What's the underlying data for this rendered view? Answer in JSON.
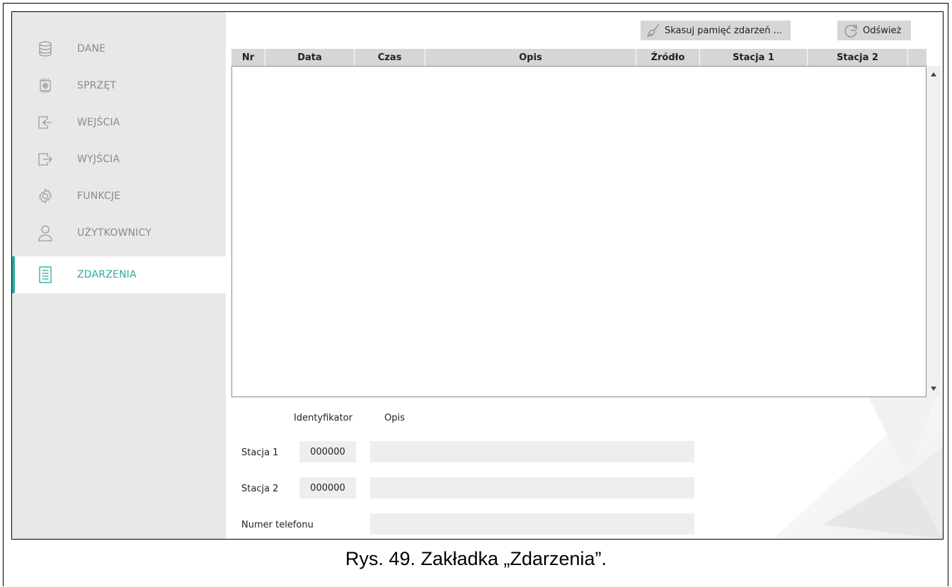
{
  "sidebar": {
    "items": [
      {
        "label": "DANE",
        "icon": "database-icon"
      },
      {
        "label": "SPRZĘT",
        "icon": "chip-icon"
      },
      {
        "label": "WEJŚCIA",
        "icon": "input-icon"
      },
      {
        "label": "WYJŚCIA",
        "icon": "output-icon"
      },
      {
        "label": "FUNKCJE",
        "icon": "gear-icon"
      },
      {
        "label": "UŻYTKOWNICY",
        "icon": "user-icon"
      },
      {
        "label": "ZDARZENIA",
        "icon": "document-list-icon",
        "active": true
      }
    ]
  },
  "toolbar": {
    "clear_label": "Skasuj pamięć zdarzeń ...",
    "refresh_label": "Odśwież"
  },
  "table": {
    "columns": [
      "Nr",
      "Data",
      "Czas",
      "Opis",
      "Źródło",
      "Stacja 1",
      "Stacja 2"
    ],
    "rows": []
  },
  "form": {
    "header_id": "Identyfikator",
    "header_desc": "Opis",
    "station1_label": "Stacja 1",
    "station1_id": "000000",
    "station1_desc": "",
    "station2_label": "Stacja 2",
    "station2_id": "000000",
    "station2_desc": "",
    "phone_label": "Numer telefonu",
    "phone_value": ""
  },
  "caption": "Rys. 49. Zakładka „Zdarzenia”.",
  "colors": {
    "accent": "#2fa89a",
    "sidebar_bg": "#e8e8e8",
    "button_bg": "#d6d6d6"
  }
}
